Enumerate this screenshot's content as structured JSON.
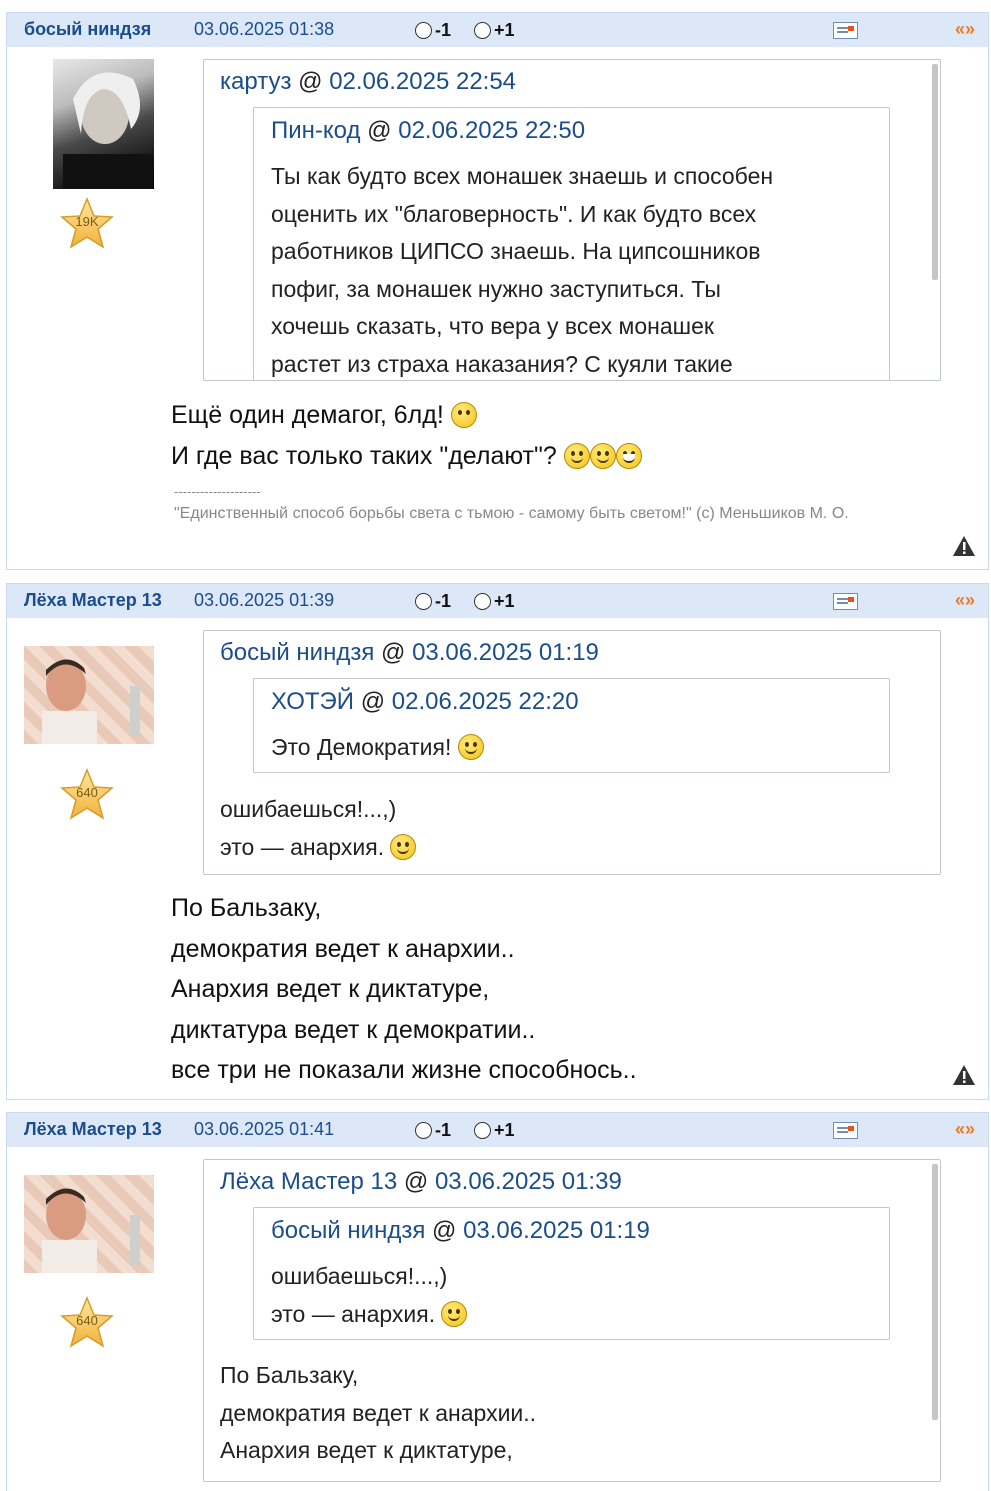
{
  "vote_minus": "-1",
  "vote_plus": "+1",
  "quote_icon": "«»",
  "separator": "@",
  "posts": [
    {
      "author": "босый ниндзя",
      "date": "03.06.2025 01:38",
      "rank": "19K",
      "quote": {
        "author": "картуз",
        "date": "02.06.2025 22:54",
        "inner": {
          "author": "Пин-код",
          "date": "02.06.2025 22:50",
          "lines": [
            "Ты как будто всех монашек знаешь и способен",
            "оценить их \"благоверность\". И как будто всех",
            "работников ЦИПСО знаешь. На ципсошников",
            "пофиг, за монашек нужно заступиться. Ты",
            "хочешь сказать, что вера у всех монашек",
            "растет из страха наказания? С куяли такие"
          ]
        }
      },
      "lines": [
        "Ещё один демагог, 6лд!",
        "И где вас только таких \"делают\"?"
      ],
      "sig_sep": "--------------------",
      "sig": "\"Единственный способ борьбы света с тьмою - самому быть светом!\" (с) Меньшиков М. О."
    },
    {
      "author": "Лёха Мастер 13",
      "date": "03.06.2025 01:39",
      "rank": "640",
      "quote": {
        "author": "босый ниндзя",
        "date": "03.06.2025 01:19",
        "inner": {
          "author": "ХОТЭЙ",
          "date": "02.06.2025 22:20",
          "lines": [
            "Это Демократия!"
          ]
        },
        "lines": [
          "ошибаешься!...,)",
          "это — анархия."
        ]
      },
      "lines": [
        "По Бальзаку,",
        "демократия ведет к анархии..",
        "Анархия ведет к диктатуре,",
        "диктатура ведет к демократии..",
        "все три не показали жизне способнось.."
      ]
    },
    {
      "author": "Лёха Мастер 13",
      "date": "03.06.2025 01:41",
      "rank": "640",
      "quote": {
        "author": "Лёха Мастер 13",
        "date": "03.06.2025 01:39",
        "inner": {
          "author": "босый ниндзя",
          "date": "03.06.2025 01:19",
          "lines": [
            "ошибаешься!...,)",
            "это — анархия."
          ]
        },
        "lines": [
          "По Бальзаку,",
          "демократия ведет к анархии..",
          "Анархия ведет к диктатуре,"
        ]
      }
    }
  ]
}
